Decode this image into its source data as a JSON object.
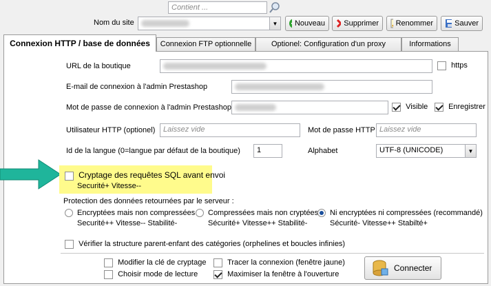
{
  "header": {
    "search_placeholder": "Contient ...",
    "site_label": "Nom du site",
    "buttons": {
      "new": "Nouveau",
      "delete": "Supprimer",
      "rename": "Renommer",
      "save": "Sauver"
    }
  },
  "tabs": [
    "Connexion HTTP / base de données",
    "Connexion FTP optionnelle",
    "Optionel: Configuration d'un proxy",
    "Informations"
  ],
  "form": {
    "shop_url_label": "URL de la boutique",
    "https_label": "https",
    "admin_email_label": "E-mail de connexion à l'admin Prestashop",
    "admin_password_label": "Mot de passe de connexion à l'admin Prestashop",
    "visible_label": "Visible",
    "save_label": "Enregistrer",
    "http_user_label": "Utilisateur HTTP (optionel)",
    "http_user_placeholder": "Laissez vide",
    "http_password_label": "Mot de passe HTTP",
    "http_password_placeholder": "Laissez vide",
    "language_id_label": "Id de la langue (0=langue par défaut de la boutique)",
    "language_id_value": "1",
    "alphabet_label": "Alphabet",
    "alphabet_value": "UTF-8 (UNICODE)",
    "sql_encrypt_label": "Cryptage des requêtes SQL avant envoi",
    "sql_encrypt_sub": "Securité+ Vitesse--",
    "protection_label": "Protection des données retournées par le serveur :",
    "radio_options": [
      {
        "label": "Encryptées mais non compressées",
        "sub": "Securité++ Vitesse-- Stabilité-"
      },
      {
        "label": "Compressées mais non cryptées",
        "sub": "Sécurité+ Vitesse++ Stabilité-"
      },
      {
        "label": "Ni encryptées ni compressées (recommandé)",
        "sub": "Sécurité- Vitesse++ Stabilté+"
      }
    ],
    "verify_structure_label": "Vérifier la structure parent-enfant des catégories (orphelines et boucles infinies)"
  },
  "bottom": {
    "modify_key_label": "Modifier la clé de cryptage",
    "read_mode_label": "Choisir mode de lecture",
    "trace_label": "Tracer la connexion (fenêtre jaune)",
    "maximize_label": "Maximiser la fenêtre à l'ouverture",
    "connect_label": "Connecter"
  },
  "colors": {
    "highlight": "#fffb8c",
    "arrow": "#1fb59b",
    "radio_selected": "#1b4f9c"
  },
  "state": {
    "https_checked": false,
    "visible_checked": true,
    "save_checked": true,
    "sql_encrypt_checked": false,
    "selected_radio": 2,
    "verify_checked": false,
    "modify_key_checked": false,
    "read_mode_checked": false,
    "trace_checked": false,
    "maximize_checked": true
  }
}
